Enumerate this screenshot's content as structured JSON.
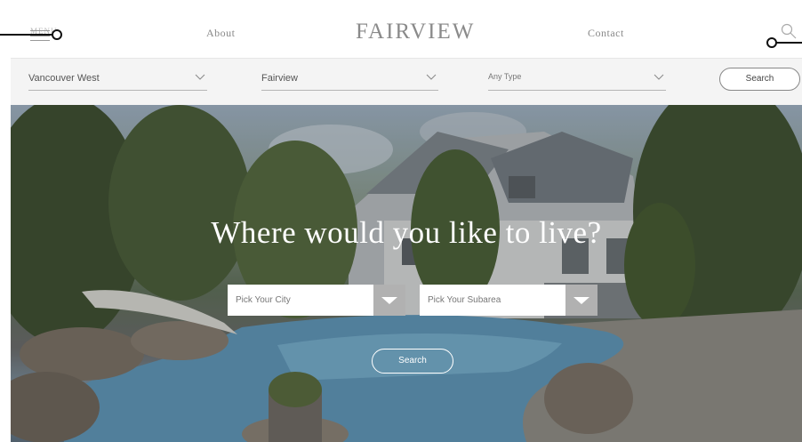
{
  "header": {
    "menu_label": "MENU",
    "about": "About",
    "brand": "FAIRVIEW",
    "contact": "Contact"
  },
  "filters": {
    "region": "Vancouver West",
    "subarea": "Fairview",
    "type": "Any Type",
    "search_label": "Search"
  },
  "hero": {
    "title": "Where would you like to live?",
    "city_placeholder": "Pick Your City",
    "subarea_placeholder": "Pick Your Subarea",
    "search_label": "Search"
  },
  "icons": [
    "menu-icon",
    "search-icon",
    "chevron-down-icon"
  ]
}
